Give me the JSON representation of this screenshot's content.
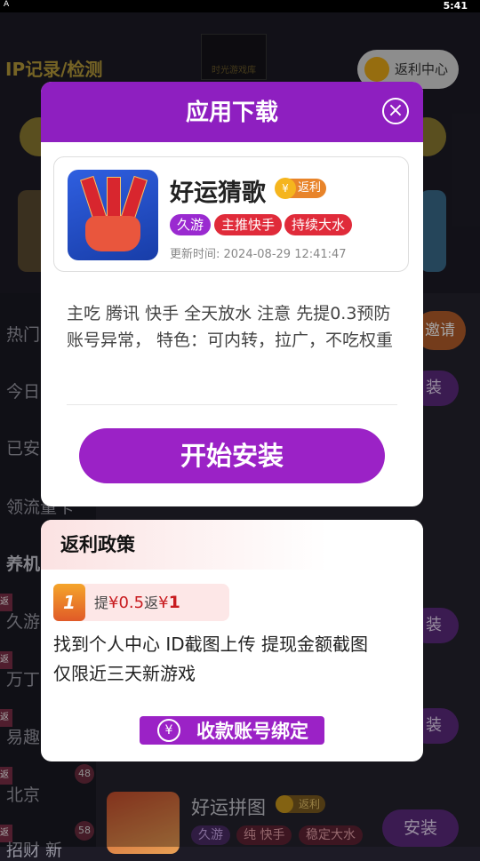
{
  "status_bar": {
    "left_glyph": "A",
    "time": "5:41"
  },
  "background": {
    "header_title": "IP记录/检测",
    "logo_text": "时光游戏库",
    "rebate_center": "返利中心",
    "sidebar_items": [
      "热门",
      "今日",
      "已安",
      "领流量卡",
      "养机",
      "久游",
      "万丁",
      "易趣",
      "北京",
      "招财 新"
    ],
    "sidebar_tag": "返",
    "sidebar_counts": [
      "48",
      "58"
    ],
    "invite_label": "邀请",
    "install_label": "装",
    "game_row": {
      "name": "好运拼图",
      "rebate_badge": "返利",
      "tags": [
        "久游",
        "纯 快手",
        "稳定大水"
      ],
      "install": "安装"
    }
  },
  "dialog": {
    "title": "应用下载",
    "close_icon": "close-circle-icon",
    "app": {
      "name": "好运猜歌",
      "rebate_badge": "返利",
      "coin_symbol": "¥",
      "tags": [
        "久游",
        "主推快手",
        "持续大水"
      ],
      "updated": "更新时间: 2024-08-29 12:41:47"
    },
    "description": "主吃 腾讯 快手 全天放水 注意 先提0.3预防账号异常， 特色：可内转，拉广，不吃权重",
    "install_button": "开始安装"
  },
  "policy": {
    "title": "返利政策",
    "rule": {
      "index": "1",
      "withdraw_prefix": "提",
      "withdraw_amount": "¥0.5",
      "rebate_prefix": "返",
      "rebate_currency": "¥",
      "rebate_amount": "1"
    },
    "description_lines": [
      "找到个人中心 ID截图上传 提现金额截图",
      "仅限近三天新游戏"
    ],
    "bind_button": "收款账号绑定",
    "bind_icon_symbol": "¥"
  },
  "colors": {
    "accent": "#9b22c6",
    "header_purple": "#8e1fc0",
    "tag_red": "#e02b3a",
    "gold": "#f5b51e"
  }
}
